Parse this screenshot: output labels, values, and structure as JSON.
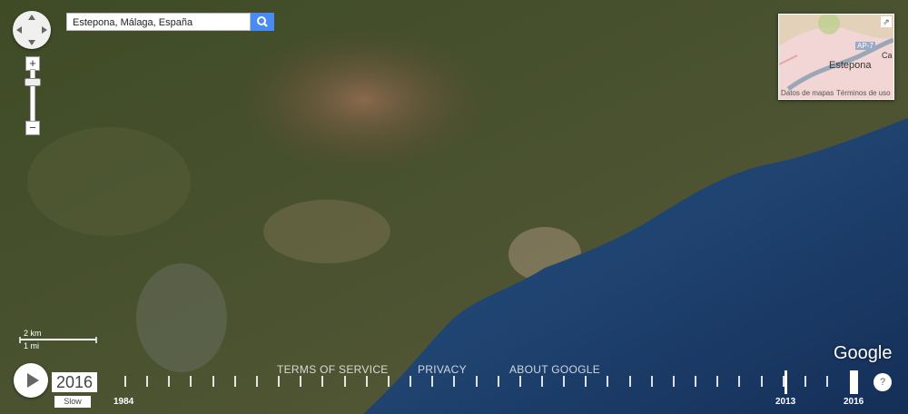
{
  "search": {
    "value": "Estepona, Málaga, España"
  },
  "inset": {
    "city": "Estepona",
    "road": "AP-7",
    "edge_label": "Ca",
    "footer_left": "Datos de mapas",
    "footer_right": "Términos de uso"
  },
  "scale": {
    "metric": "2 km",
    "imperial": "1 mi"
  },
  "timelapse": {
    "current_year": "2016",
    "speed": "Slow",
    "start_year": "1984",
    "marker_year": "2013",
    "end_year": "2016"
  },
  "footer_links": {
    "terms": "TERMS OF SERVICE",
    "privacy": "PRIVACY",
    "about": "ABOUT GOOGLE"
  },
  "brand": "Google",
  "help": "?",
  "icons": [
    "pan-control-icon",
    "search-icon",
    "expand-icon",
    "play-icon",
    "help-icon"
  ],
  "colors": {
    "sea": "#1c3a66",
    "land": "#3c4a25",
    "search_button": "#4a8af4",
    "inset_map": "#f2d5d5"
  }
}
